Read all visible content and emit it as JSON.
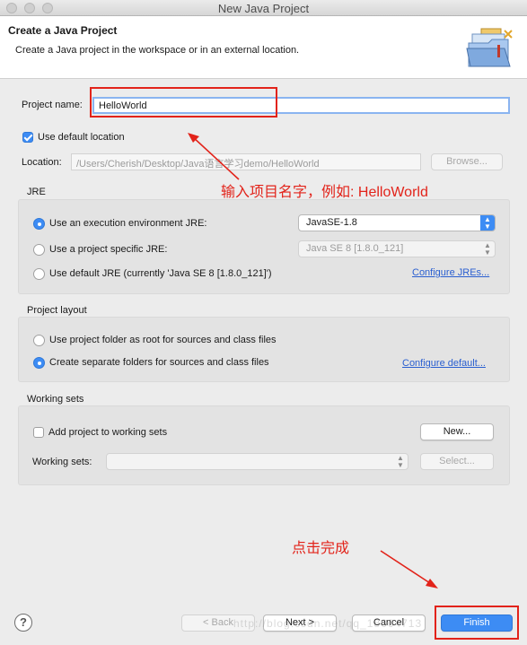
{
  "window": {
    "title": "New Java Project"
  },
  "header": {
    "title": "Create a Java Project",
    "description": "Create a Java project in the workspace or in an external location.",
    "icon": "folder-wizard-icon"
  },
  "project": {
    "name_label": "Project name:",
    "name_value": "HelloWorld",
    "use_default_label": "Use default location",
    "use_default_checked": true,
    "location_label": "Location:",
    "location_value": "/Users/Cherish/Desktop/Java语言学习demo/HelloWorld",
    "browse_label": "Browse..."
  },
  "jre": {
    "title": "JRE",
    "options": [
      {
        "label": "Use an execution environment JRE:",
        "selected": true,
        "value": "JavaSE-1.8"
      },
      {
        "label": "Use a project specific JRE:",
        "selected": false,
        "value": "Java SE 8 [1.8.0_121]"
      },
      {
        "label": "Use default JRE (currently 'Java SE 8 [1.8.0_121]')",
        "selected": false
      }
    ],
    "configure_link": "Configure JREs..."
  },
  "layout": {
    "title": "Project layout",
    "options": [
      {
        "label": "Use project folder as root for sources and class files",
        "selected": false
      },
      {
        "label": "Create separate folders for sources and class files",
        "selected": true
      }
    ],
    "configure_link": "Configure default..."
  },
  "working_sets": {
    "title": "Working sets",
    "add_label": "Add project to working sets",
    "add_checked": false,
    "new_label": "New...",
    "sets_label": "Working sets:",
    "sets_value": "",
    "select_label": "Select..."
  },
  "annotations": {
    "name_hint": "输入项目名字，例如: HelloWorld",
    "finish_hint": "点击完成"
  },
  "footer": {
    "help": "?",
    "back": "< Back",
    "next": "Next >",
    "cancel": "Cancel",
    "finish": "Finish",
    "watermark": "http://blog.csdn.net/qq_18664713"
  },
  "colors": {
    "accent": "#3d8cf4",
    "annotation": "#e2231a",
    "link": "#2a5fd0"
  }
}
